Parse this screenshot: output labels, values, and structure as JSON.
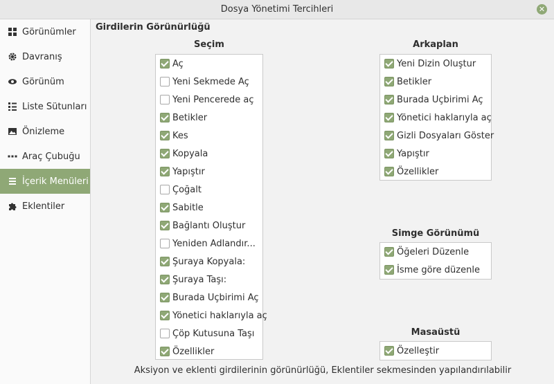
{
  "window": {
    "title": "Dosya Yönetimi Tercihleri",
    "close_icon": "close-icon"
  },
  "accent": "#8fa876",
  "sidebar": {
    "items": [
      {
        "label": "Görünümler",
        "icon": "grid-icon",
        "active": false
      },
      {
        "label": "Davranış",
        "icon": "gear-icon",
        "active": false
      },
      {
        "label": "Görünüm",
        "icon": "eye-icon",
        "active": false
      },
      {
        "label": "Liste Sütunları",
        "icon": "list-columns-icon",
        "active": false
      },
      {
        "label": "Önizleme",
        "icon": "image-icon",
        "active": false
      },
      {
        "label": "Araç Çubuğu",
        "icon": "dots-icon",
        "active": false
      },
      {
        "label": "İçerik Menüleri",
        "icon": "menu-icon",
        "active": true
      },
      {
        "label": "Eklentiler",
        "icon": "puzzle-icon",
        "active": false
      }
    ]
  },
  "main": {
    "section_title": "Girdilerin Görünürlüğü",
    "selection": {
      "title": "Seçim",
      "items": [
        {
          "label": "Aç",
          "checked": true
        },
        {
          "label": "Yeni Sekmede Aç",
          "checked": false
        },
        {
          "label": "Yeni Pencerede aç",
          "checked": false
        },
        {
          "label": "Betikler",
          "checked": true
        },
        {
          "label": "Kes",
          "checked": true
        },
        {
          "label": "Kopyala",
          "checked": true
        },
        {
          "label": "Yapıştır",
          "checked": true
        },
        {
          "label": "Çoğalt",
          "checked": false
        },
        {
          "label": "Sabitle",
          "checked": true
        },
        {
          "label": "Bağlantı Oluştur",
          "checked": true
        },
        {
          "label": "Yeniden Adlandır...",
          "checked": false
        },
        {
          "label": "Şuraya Kopyala:",
          "checked": true
        },
        {
          "label": "Şuraya Taşı:",
          "checked": true
        },
        {
          "label": "Burada Uçbirimi Aç",
          "checked": true
        },
        {
          "label": "Yönetici haklarıyla aç",
          "checked": true
        },
        {
          "label": "Çöp Kutusuna Taşı",
          "checked": false
        },
        {
          "label": "Özellikler",
          "checked": true
        }
      ]
    },
    "background": {
      "title": "Arkaplan",
      "items": [
        {
          "label": "Yeni Dizin Oluştur",
          "checked": true
        },
        {
          "label": "Betikler",
          "checked": true
        },
        {
          "label": "Burada Uçbirimi Aç",
          "checked": true
        },
        {
          "label": "Yönetici haklarıyla aç",
          "checked": true
        },
        {
          "label": "Gizli Dosyaları Göster",
          "checked": true
        },
        {
          "label": "Yapıştır",
          "checked": true
        },
        {
          "label": "Özellikler",
          "checked": true
        }
      ]
    },
    "icon_view": {
      "title": "Simge Görünümü",
      "items": [
        {
          "label": "Öğeleri Düzenle",
          "checked": true
        },
        {
          "label": "İsme göre düzenle",
          "checked": true
        }
      ]
    },
    "desktop": {
      "title": "Masaüstü",
      "items": [
        {
          "label": "Özelleştir",
          "checked": true
        }
      ]
    },
    "footer": "Aksiyon ve eklenti girdilerinin görünürlüğü, Eklentiler sekmesinden yapılandırılabilir"
  }
}
